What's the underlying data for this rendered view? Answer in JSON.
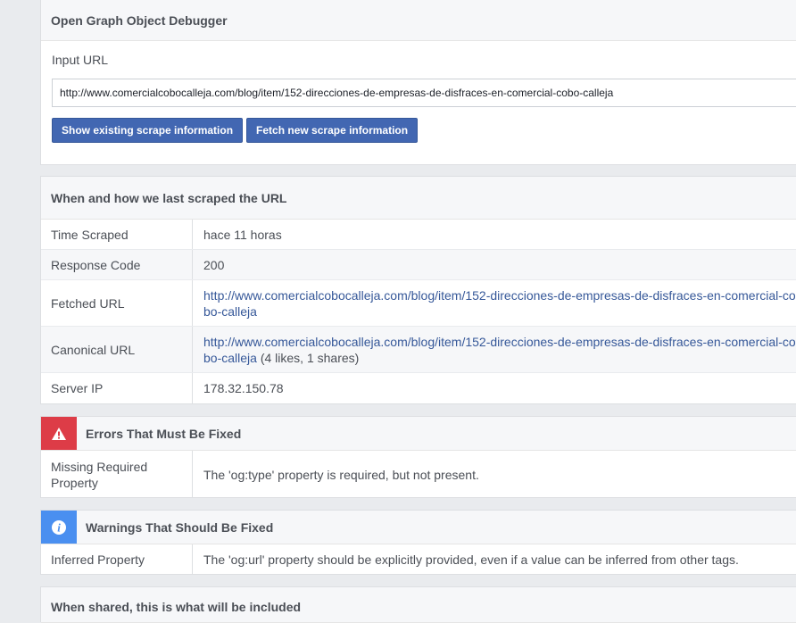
{
  "debugger": {
    "title": "Open Graph Object Debugger",
    "input_label": "Input URL",
    "input_value": "http://www.comercialcobocalleja.com/blog/item/152-direcciones-de-empresas-de-disfraces-en-comercial-cobo-calleja",
    "show_button": "Show existing scrape information",
    "fetch_button": "Fetch new scrape information"
  },
  "scrape": {
    "title": "When and how we last scraped the URL",
    "rows": {
      "time": {
        "label": "Time Scraped",
        "value": "hace 11 horas"
      },
      "response": {
        "label": "Response Code",
        "value": "200"
      },
      "fetched": {
        "label": "Fetched URL",
        "value": "http://www.comercialcobocalleja.com/blog/item/152-direcciones-de-empresas-de-disfraces-en-comercial-cobo-calleja"
      },
      "canonical": {
        "label": "Canonical URL",
        "value": "http://www.comercialcobocalleja.com/blog/item/152-direcciones-de-empresas-de-disfraces-en-comercial-cobo-calleja",
        "extra": " (4 likes, 1 shares)"
      },
      "server_ip": {
        "label": "Server IP",
        "value": "178.32.150.78"
      }
    }
  },
  "errors": {
    "icon": "warning-triangle-icon",
    "title": "Errors That Must Be Fixed",
    "rows": [
      {
        "label": "Missing Required Property",
        "value": "The 'og:type' property is required, but not present."
      }
    ]
  },
  "warnings": {
    "icon": "info-icon",
    "title": "Warnings That Should Be Fixed",
    "rows": [
      {
        "label": "Inferred Property",
        "value": "The 'og:url' property should be explicitly provided, even if a value can be inferred from other tags."
      }
    ]
  },
  "shared": {
    "title": "When shared, this is what will be included"
  },
  "colors": {
    "button": "#4267b2",
    "link": "#365899",
    "error": "#dd3c47",
    "warning": "#4a8ff0"
  }
}
